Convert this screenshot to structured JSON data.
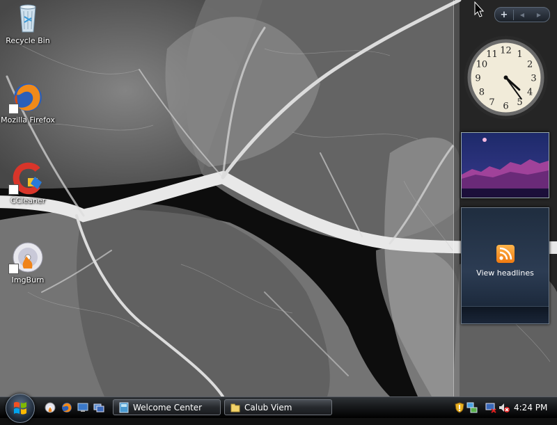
{
  "desktop": {
    "icons": [
      {
        "label": "Recycle Bin",
        "icon": "recycle-bin-icon"
      },
      {
        "label": "Mozilla Firefox",
        "icon": "firefox-icon"
      },
      {
        "label": "CCleaner",
        "icon": "ccleaner-icon"
      },
      {
        "label": "ImgBurn",
        "icon": "imgburn-icon"
      }
    ]
  },
  "sidebar": {
    "add_label": "+",
    "prev_label": "◀",
    "next_label": "▶",
    "clock_numbers": [
      "12",
      "1",
      "2",
      "3",
      "4",
      "5",
      "6",
      "7",
      "8",
      "9",
      "10",
      "11"
    ],
    "clock_time": {
      "hours": 4,
      "minutes": 24
    },
    "feed_label": "View headlines"
  },
  "taskbar": {
    "quick_launch": [
      "imgburn-icon",
      "firefox-icon",
      "show-desktop-icon",
      "switch-windows-icon"
    ],
    "tasks": [
      {
        "label": "Welcome Center",
        "icon": "welcome-center-icon"
      },
      {
        "label": "Calub Viem",
        "icon": "folder-icon"
      }
    ],
    "tray_icons": [
      "security-shield-icon",
      "network-icon",
      "monitor-icon",
      "volume-muted-icon"
    ],
    "clock": "4:24 PM"
  },
  "colors": {
    "feed_accent": "#f07a10",
    "taskbar": "#17191b"
  }
}
